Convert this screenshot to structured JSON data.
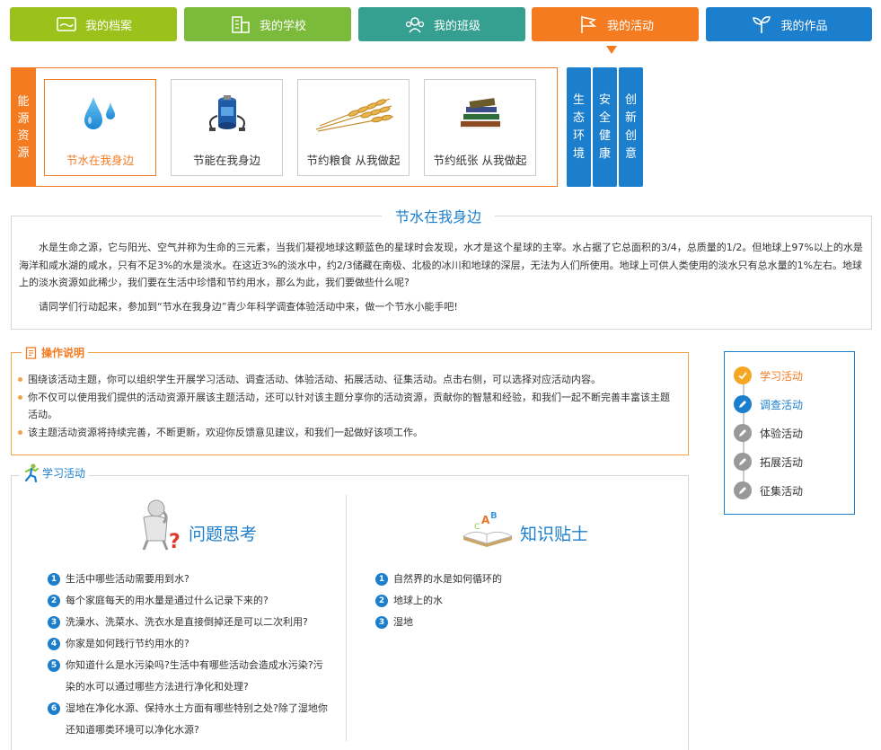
{
  "nav": {
    "tabs": [
      {
        "label": "我的档案",
        "color": "#9ac21b",
        "icon": "profile-icon"
      },
      {
        "label": "我的学校",
        "color": "#7cba3b",
        "icon": "school-icon"
      },
      {
        "label": "我的班级",
        "color": "#36a090",
        "icon": "class-icon"
      },
      {
        "label": "我的活动",
        "color": "#f47b20",
        "icon": "flag-icon"
      },
      {
        "label": "我的作品",
        "color": "#1c7fcd",
        "icon": "sprout-icon"
      }
    ]
  },
  "category": {
    "side_label": "能源资源",
    "cards": [
      {
        "label": "节水在我身边",
        "icon": "water-drop-icon"
      },
      {
        "label": "节能在我身边",
        "icon": "battery-icon"
      },
      {
        "label": "节约粮食 从我做起",
        "icon": "wheat-icon"
      },
      {
        "label": "节约纸张 从我做起",
        "icon": "books-icon"
      }
    ],
    "right_tabs": [
      "生态环境",
      "安全健康",
      "创新创意"
    ]
  },
  "intro": {
    "title": "节水在我身边",
    "p1": "水是生命之源，它与阳光、空气并称为生命的三元素，当我们凝视地球这颗蓝色的星球时会发现，水才是这个星球的主宰。水占据了它总面积的3/4，总质量的1/2。但地球上97%以上的水是海洋和咸水湖的咸水，只有不足3%的水是淡水。在这近3%的淡水中，约2/3储藏在南极、北极的冰川和地球的深层，无法为人们所使用。地球上可供人类使用的淡水只有总水量的1%左右。地球上的淡水资源如此稀少，我们要在生活中珍惜和节约用水，那么为此，我们要做些什么呢?",
    "p2": "请同学们行动起来，参加到“节水在我身边”青少年科学调查体验活动中来，做一个节水小能手吧!"
  },
  "ops": {
    "title": "操作说明",
    "items": [
      "围绕该活动主题，你可以组织学生开展学习活动、调查活动、体验活动、拓展活动、征集活动。点击右侧，可以选择对应活动内容。",
      "你不仅可以使用我们提供的活动资源开展该主题活动，还可以针对该主题分享你的活动资源，贡献你的智慧和经验，和我们一起不断完善丰富该主题活动。",
      "该主题活动资源将持续完善，不断更新，欢迎你反馈意见建议，和我们一起做好该项工作。"
    ]
  },
  "steps": [
    {
      "label": "学习活动",
      "state": "done",
      "color": "#f47b20"
    },
    {
      "label": "调查活动",
      "state": "current",
      "color": "#1c7fcd"
    },
    {
      "label": "体验活动",
      "state": "todo",
      "color": "#333333"
    },
    {
      "label": "拓展活动",
      "state": "todo",
      "color": "#333333"
    },
    {
      "label": "征集活动",
      "state": "todo",
      "color": "#333333"
    }
  ],
  "study": {
    "title": "学习活动",
    "left_heading": "问题思考",
    "right_heading": "知识贴士",
    "questions": [
      [
        "生活中哪些活动需要用到水?"
      ],
      [
        "每个家庭每天的用水量是通过什么记录下来的?"
      ],
      [
        "洗澡水、洗菜水、洗衣水是直接倒掉还是可以二次利用?"
      ],
      [
        "你家是如何践行节约用水的?"
      ],
      [
        "你知道什么是水污染吗?生活中有哪些活动会造成水污染?污",
        "染的水可以通过哪些方法进行净化和处理?"
      ],
      [
        "湿地在净化水源、保持水土方面有哪些特别之处?除了湿地你",
        "还知道哪类环境可以净化水源?"
      ]
    ],
    "tips": [
      "自然界的水是如何循环的",
      "地球上的水",
      "湿地"
    ]
  }
}
